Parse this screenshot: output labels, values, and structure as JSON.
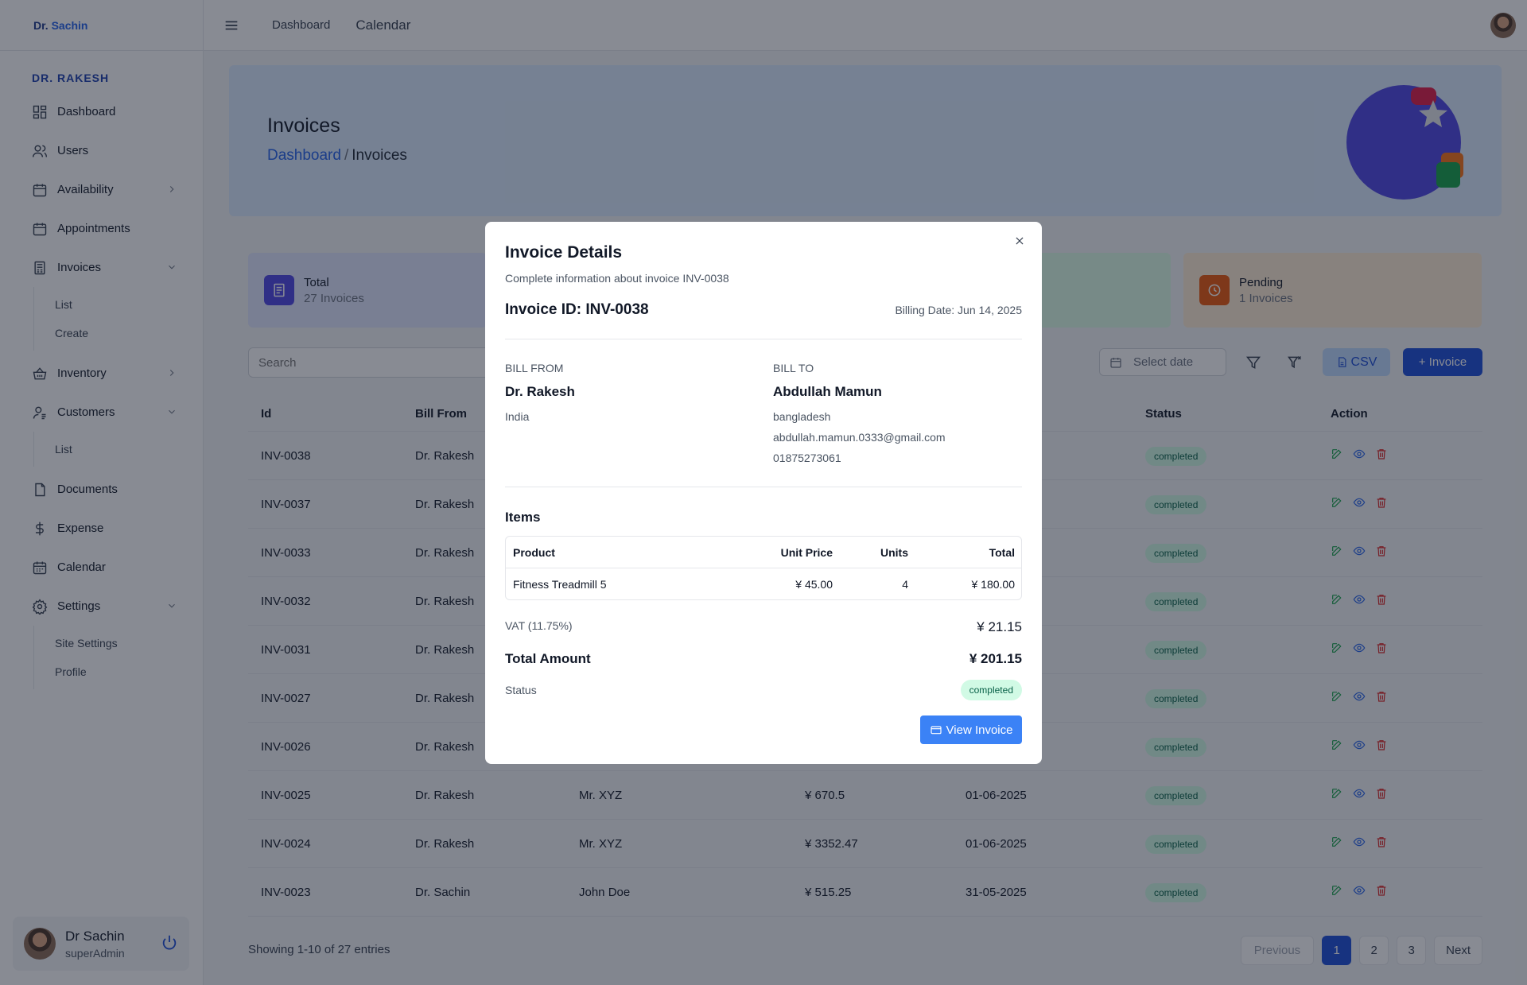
{
  "app": {
    "logo_prefix": "Dr.",
    "logo_name": "Sachin"
  },
  "sidebar": {
    "section": "DR. RAKESH",
    "items": [
      {
        "label": "Dashboard",
        "icon": "dashboard-icon"
      },
      {
        "label": "Users",
        "icon": "users-icon"
      },
      {
        "label": "Availability",
        "icon": "calendar-icon"
      },
      {
        "label": "Appointments",
        "icon": "calendar-icon"
      },
      {
        "label": "Invoices",
        "icon": "invoice-icon"
      },
      {
        "label": "Inventory",
        "icon": "basket-icon"
      },
      {
        "label": "Customers",
        "icon": "customer-icon"
      },
      {
        "label": "Documents",
        "icon": "document-icon"
      },
      {
        "label": "Expense",
        "icon": "dollar-icon"
      },
      {
        "label": "Calendar",
        "icon": "calendar-icon"
      },
      {
        "label": "Settings",
        "icon": "gear-icon"
      }
    ],
    "invoices_sub": [
      "List",
      "Create"
    ],
    "customers_sub": [
      "List"
    ],
    "settings_sub": [
      "Site Settings",
      "Profile"
    ],
    "user": {
      "name": "Dr Sachin",
      "role": "superAdmin"
    }
  },
  "topbar": {
    "links": [
      "Dashboard",
      "Calendar"
    ]
  },
  "hero": {
    "title": "Invoices",
    "crumb_link": "Dashboard",
    "crumb_sep": "/",
    "crumb_current": "Invoices"
  },
  "stats": {
    "total": {
      "label": "Total",
      "value": "27 Invoices"
    },
    "pending": {
      "label": "Pending",
      "value": "1 Invoices"
    }
  },
  "toolbar": {
    "search_placeholder": "Search",
    "date_placeholder": "Select date",
    "csv_label": "CSV",
    "add_label": "+ Invoice"
  },
  "table": {
    "headers": [
      "Id",
      "Bill From",
      "",
      "",
      "",
      "Status",
      "Action"
    ],
    "rows": [
      {
        "id": "INV-0038",
        "from": "Dr. Rakesh",
        "to": "",
        "amount": "",
        "date": "",
        "status": "completed"
      },
      {
        "id": "INV-0037",
        "from": "Dr. Rakesh",
        "to": "",
        "amount": "",
        "date": "",
        "status": "completed"
      },
      {
        "id": "INV-0033",
        "from": "Dr. Rakesh",
        "to": "",
        "amount": "",
        "date": "",
        "status": "completed"
      },
      {
        "id": "INV-0032",
        "from": "Dr. Rakesh",
        "to": "",
        "amount": "",
        "date": "",
        "status": "completed"
      },
      {
        "id": "INV-0031",
        "from": "Dr. Rakesh",
        "to": "",
        "amount": "",
        "date": "",
        "status": "completed"
      },
      {
        "id": "INV-0027",
        "from": "Dr. Rakesh",
        "to": "",
        "amount": "",
        "date": "",
        "status": "completed"
      },
      {
        "id": "INV-0026",
        "from": "Dr. Rakesh",
        "to": "",
        "amount": "",
        "date": "",
        "status": "completed"
      },
      {
        "id": "INV-0025",
        "from": "Dr. Rakesh",
        "to": "Mr. XYZ",
        "amount": "¥ 670.5",
        "date": "01-06-2025",
        "status": "completed"
      },
      {
        "id": "INV-0024",
        "from": "Dr. Rakesh",
        "to": "Mr. XYZ",
        "amount": "¥ 3352.47",
        "date": "01-06-2025",
        "status": "completed"
      },
      {
        "id": "INV-0023",
        "from": "Dr. Sachin",
        "to": "John Doe",
        "amount": "¥ 515.25",
        "date": "31-05-2025",
        "status": "completed"
      }
    ]
  },
  "pagination": {
    "info": "Showing 1-10 of 27 entries",
    "prev": "Previous",
    "pages": [
      "1",
      "2",
      "3"
    ],
    "next": "Next"
  },
  "modal": {
    "title": "Invoice Details",
    "subtitle": "Complete information about invoice INV-0038",
    "invoice_id": "Invoice ID: INV-0038",
    "billing_date": "Billing Date: Jun 14, 2025",
    "bill_from": {
      "label": "BILL FROM",
      "name": "Dr. Rakesh",
      "country": "India"
    },
    "bill_to": {
      "label": "BILL TO",
      "name": "Abdullah Mamun",
      "country": "bangladesh",
      "email": "abdullah.mamun.0333@gmail.com",
      "phone": "01875273061"
    },
    "items_title": "Items",
    "items_headers": [
      "Product",
      "Unit Price",
      "Units",
      "Total"
    ],
    "items": [
      {
        "product": "Fitness Treadmill 5",
        "unit_price": "¥ 45.00",
        "units": "4",
        "total": "¥ 180.00"
      }
    ],
    "vat_label": "VAT (11.75%)",
    "vat_value": "¥ 21.15",
    "total_label": "Total Amount",
    "total_value": "¥ 201.15",
    "status_label": "Status",
    "status_value": "completed",
    "view_label": "View Invoice"
  },
  "colors": {
    "primary": "#1d4ed8",
    "completed_bg": "#d1fae5",
    "completed_text": "#065f46",
    "pending": "#ea580c",
    "total_badge": "#4f46e5"
  }
}
